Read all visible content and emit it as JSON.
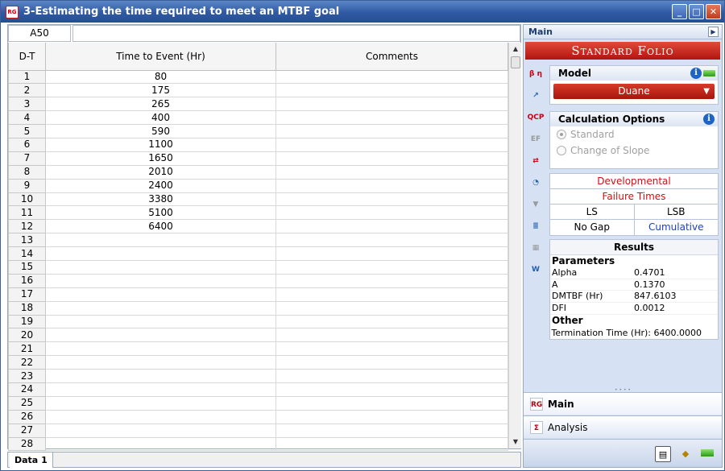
{
  "window": {
    "title": "3-Estimating the time required to meet an MTBF goal",
    "app_icon": "RG",
    "buttons": {
      "minimize": "_",
      "maximize": "□",
      "close": "✕"
    }
  },
  "sheet": {
    "cell_ref": "A50",
    "formula": "",
    "columns": [
      "D-T",
      "Time to Event (Hr)",
      "Comments"
    ],
    "rows": [
      {
        "n": "1",
        "time": "80",
        "comment": ""
      },
      {
        "n": "2",
        "time": "175",
        "comment": ""
      },
      {
        "n": "3",
        "time": "265",
        "comment": ""
      },
      {
        "n": "4",
        "time": "400",
        "comment": ""
      },
      {
        "n": "5",
        "time": "590",
        "comment": ""
      },
      {
        "n": "6",
        "time": "1100",
        "comment": ""
      },
      {
        "n": "7",
        "time": "1650",
        "comment": ""
      },
      {
        "n": "8",
        "time": "2010",
        "comment": ""
      },
      {
        "n": "9",
        "time": "2400",
        "comment": ""
      },
      {
        "n": "10",
        "time": "3380",
        "comment": ""
      },
      {
        "n": "11",
        "time": "5100",
        "comment": ""
      },
      {
        "n": "12",
        "time": "6400",
        "comment": ""
      },
      {
        "n": "13",
        "time": "",
        "comment": ""
      },
      {
        "n": "14",
        "time": "",
        "comment": ""
      },
      {
        "n": "15",
        "time": "",
        "comment": ""
      },
      {
        "n": "16",
        "time": "",
        "comment": ""
      },
      {
        "n": "17",
        "time": "",
        "comment": ""
      },
      {
        "n": "18",
        "time": "",
        "comment": ""
      },
      {
        "n": "19",
        "time": "",
        "comment": ""
      },
      {
        "n": "20",
        "time": "",
        "comment": ""
      },
      {
        "n": "21",
        "time": "",
        "comment": ""
      },
      {
        "n": "22",
        "time": "",
        "comment": ""
      },
      {
        "n": "23",
        "time": "",
        "comment": ""
      },
      {
        "n": "24",
        "time": "",
        "comment": ""
      },
      {
        "n": "25",
        "time": "",
        "comment": ""
      },
      {
        "n": "26",
        "time": "",
        "comment": ""
      },
      {
        "n": "27",
        "time": "",
        "comment": ""
      },
      {
        "n": "28",
        "time": "",
        "comment": ""
      }
    ],
    "tab": "Data 1"
  },
  "panel": {
    "header": "Main",
    "banner": "Standard Folio",
    "model": {
      "title": "Model",
      "value": "Duane"
    },
    "calc": {
      "title": "Calculation Options",
      "options": [
        "Standard",
        "Change of Slope"
      ],
      "selected": "Standard"
    },
    "status": {
      "type": "Developmental",
      "data": "Failure Times",
      "ls": "LS",
      "lsb": "LSB",
      "gap": "No Gap",
      "mode": "Cumulative"
    },
    "results": {
      "title": "Results",
      "parameters_label": "Parameters",
      "parameters": [
        {
          "k": "Alpha",
          "v": "0.4701"
        },
        {
          "k": "A",
          "v": "0.1370"
        },
        {
          "k": "DMTBF (Hr)",
          "v": "847.6103"
        },
        {
          "k": "DFI",
          "v": "0.0012"
        }
      ],
      "other_label": "Other",
      "termination": "Termination Time (Hr): 6400.0000"
    },
    "nav": {
      "main": "Main",
      "analysis": "Analysis"
    },
    "tools": [
      "parameters-icon",
      "plot-icon",
      "qcp-icon",
      "ef-icon",
      "transfer-icon",
      "gauge-icon",
      "filter-icon",
      "report-icon",
      "sheet-icon",
      "weibull-icon"
    ],
    "colors": {
      "accent_red": "#c0160d",
      "link_blue": "#1a3fc4",
      "panel_bg": "#d6e2f3"
    }
  }
}
